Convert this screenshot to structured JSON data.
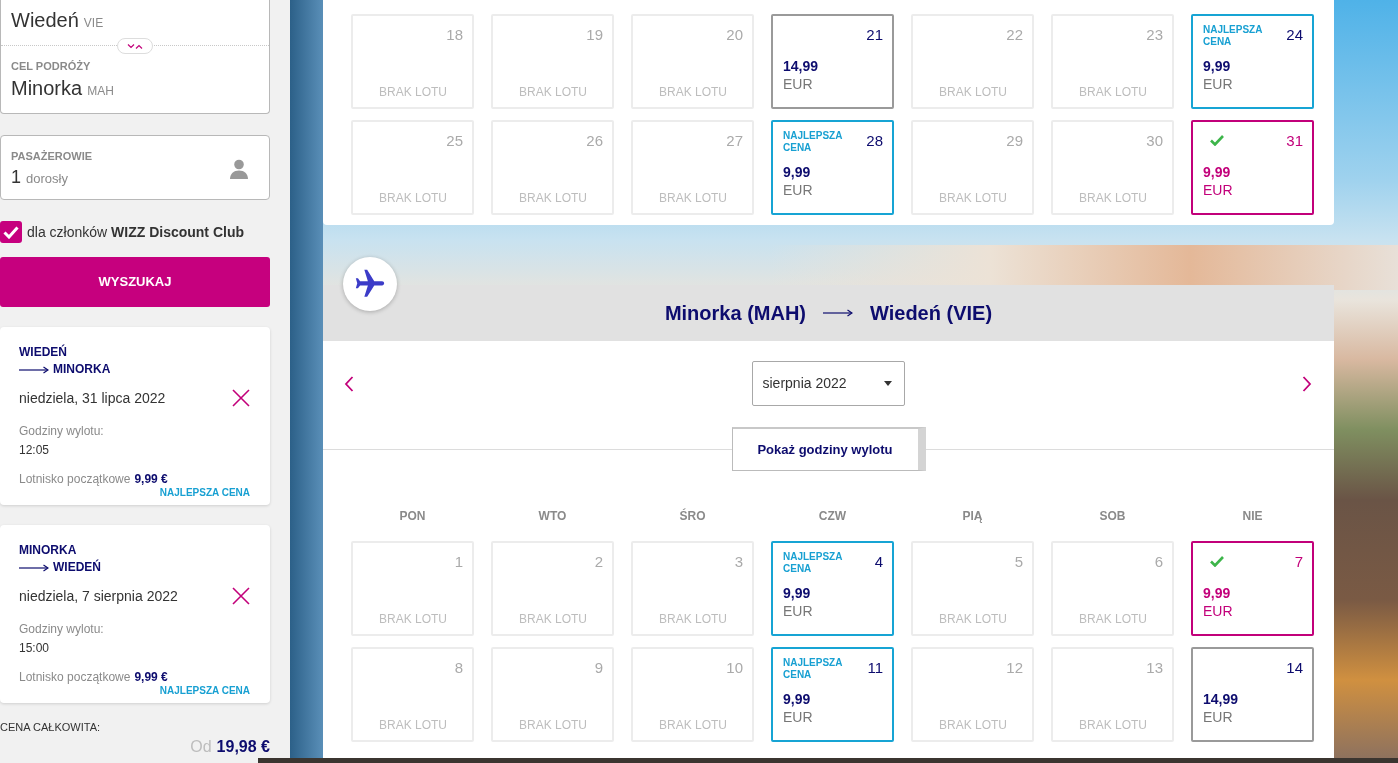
{
  "sidebar": {
    "origin": {
      "city": "Wiedeń",
      "code": "VIE"
    },
    "destination": {
      "label": "CEL PODRÓŻY",
      "city": "Minorka",
      "code": "MAH"
    },
    "passengers": {
      "label": "PASAŻEROWIE",
      "count": "1",
      "unit": "dorosły"
    },
    "discount_club": {
      "checked": true,
      "label": "dla członków **WIZZ Discount Club**"
    },
    "search_button": "WYSZUKAJ",
    "flights": [
      {
        "from": "WIEDEŃ",
        "to": "MINORKA",
        "date": "niedziela, 31 lipca 2022",
        "times_label": "Godziny wylotu:",
        "time": "12:05",
        "fare_label": "Lotnisko początkowe",
        "fare": "9,99 €",
        "badge": "NAJLEPSZA CENA"
      },
      {
        "from": "MINORKA",
        "to": "WIEDEŃ",
        "date": "niedziela, 7 sierpnia 2022",
        "times_label": "Godziny wylotu:",
        "time": "15:00",
        "fare_label": "Lotnisko początkowe",
        "fare": "9,99 €",
        "badge": "NAJLEPSZA CENA"
      }
    ],
    "total": {
      "label": "CENA CAŁKOWITA:",
      "prefix": "Od",
      "amount": "19,98 €"
    }
  },
  "outbound_calendar": {
    "weeks": [
      [
        {
          "day": "18",
          "kind": "no_flight",
          "note": "BRAK LOTU",
          "selected": false
        },
        {
          "day": "19",
          "kind": "no_flight",
          "note": "BRAK LOTU",
          "selected": false
        },
        {
          "day": "20",
          "kind": "no_flight",
          "note": "BRAK LOTU",
          "selected": false
        },
        {
          "day": "21",
          "kind": "fare",
          "price": "14,99",
          "currency": "EUR",
          "selected": false
        },
        {
          "day": "22",
          "kind": "no_flight",
          "note": "BRAK LOTU",
          "selected": false
        },
        {
          "day": "23",
          "kind": "no_flight",
          "note": "BRAK LOTU",
          "selected": false
        },
        {
          "day": "24",
          "kind": "best_fare",
          "badge": "NAJLEPSZA CENA",
          "price": "9,99",
          "currency": "EUR",
          "selected": false
        }
      ],
      [
        {
          "day": "25",
          "kind": "no_flight",
          "note": "BRAK LOTU",
          "selected": false
        },
        {
          "day": "26",
          "kind": "no_flight",
          "note": "BRAK LOTU",
          "selected": false
        },
        {
          "day": "27",
          "kind": "no_flight",
          "note": "BRAK LOTU",
          "selected": false
        },
        {
          "day": "28",
          "kind": "best_fare",
          "badge": "NAJLEPSZA CENA",
          "price": "9,99",
          "currency": "EUR",
          "selected": false
        },
        {
          "day": "29",
          "kind": "no_flight",
          "note": "BRAK LOTU",
          "selected": false
        },
        {
          "day": "30",
          "kind": "no_flight",
          "note": "BRAK LOTU",
          "selected": false
        },
        {
          "day": "31",
          "kind": "best_fare",
          "price": "9,99",
          "currency": "EUR",
          "selected": true
        }
      ]
    ]
  },
  "return_calendar": {
    "origin": "Minorka (MAH)",
    "destination": "Wiedeń (VIE)",
    "month": "sierpnia 2022",
    "times_button": "Pokaż godziny wylotu",
    "weekdays": [
      "PON",
      "WTO",
      "ŚRO",
      "CZW",
      "PIĄ",
      "SOB",
      "NIE"
    ],
    "weeks": [
      [
        {
          "day": "1",
          "kind": "no_flight",
          "note": "BRAK LOTU",
          "selected": false
        },
        {
          "day": "2",
          "kind": "no_flight",
          "note": "BRAK LOTU",
          "selected": false
        },
        {
          "day": "3",
          "kind": "no_flight",
          "note": "BRAK LOTU",
          "selected": false
        },
        {
          "day": "4",
          "kind": "best_fare",
          "badge": "NAJLEPSZA CENA",
          "price": "9,99",
          "currency": "EUR",
          "selected": false
        },
        {
          "day": "5",
          "kind": "no_flight",
          "note": "BRAK LOTU",
          "selected": false
        },
        {
          "day": "6",
          "kind": "no_flight",
          "note": "BRAK LOTU",
          "selected": false
        },
        {
          "day": "7",
          "kind": "best_fare",
          "price": "9,99",
          "currency": "EUR",
          "selected": true
        }
      ],
      [
        {
          "day": "8",
          "kind": "no_flight",
          "note": "BRAK LOTU",
          "selected": false
        },
        {
          "day": "9",
          "kind": "no_flight",
          "note": "BRAK LOTU",
          "selected": false
        },
        {
          "day": "10",
          "kind": "no_flight",
          "note": "BRAK LOTU",
          "selected": false
        },
        {
          "day": "11",
          "kind": "best_fare",
          "badge": "NAJLEPSZA CENA",
          "price": "9,99",
          "currency": "EUR",
          "selected": false
        },
        {
          "day": "12",
          "kind": "no_flight",
          "note": "BRAK LOTU",
          "selected": false
        },
        {
          "day": "13",
          "kind": "no_flight",
          "note": "BRAK LOTU",
          "selected": false
        },
        {
          "day": "14",
          "kind": "fare",
          "price": "14,99",
          "currency": "EUR",
          "selected": false
        }
      ]
    ]
  }
}
